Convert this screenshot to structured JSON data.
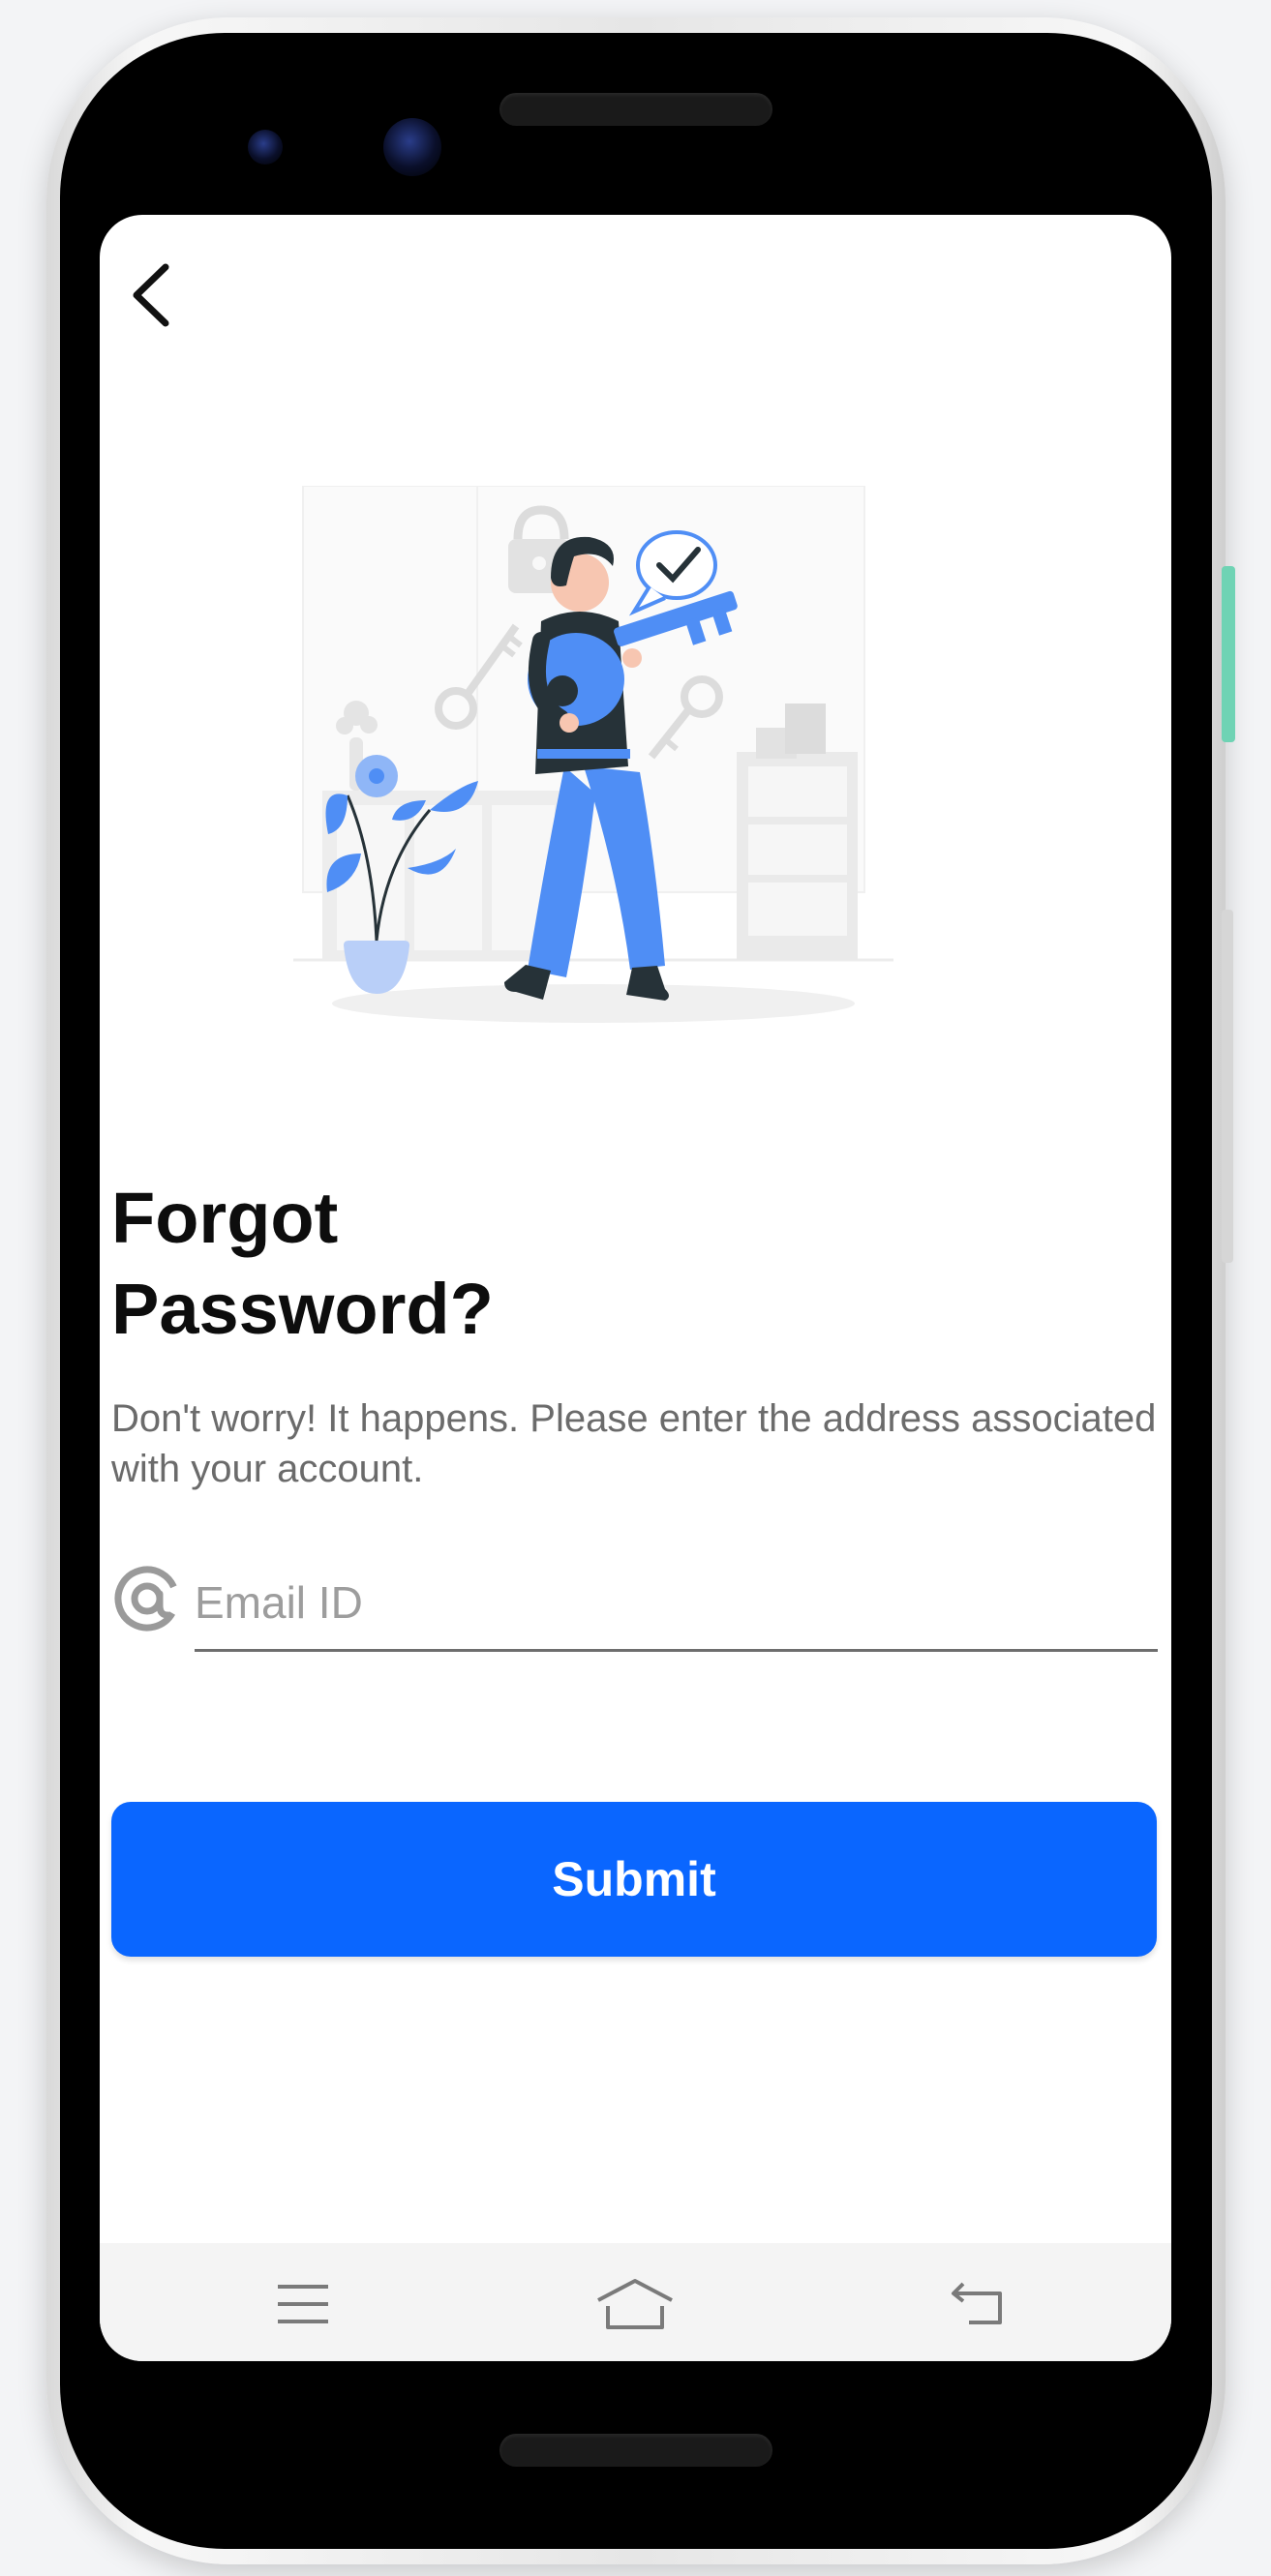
{
  "screen": {
    "title": "Forgot\nPassword?",
    "subtitle": "Don't worry! It happens. Please enter the address associated with your account.",
    "email": {
      "placeholder": "Email ID",
      "value": ""
    },
    "submit_label": "Submit"
  },
  "icons": {
    "back": "back-arrow-icon",
    "email": "at-sign-icon",
    "nav_menu": "menu-icon",
    "nav_home": "home-icon",
    "nav_back": "back-icon"
  },
  "colors": {
    "accent": "#0a66ff",
    "illustration_blue": "#4f8ef5",
    "illustration_dark": "#263238"
  }
}
